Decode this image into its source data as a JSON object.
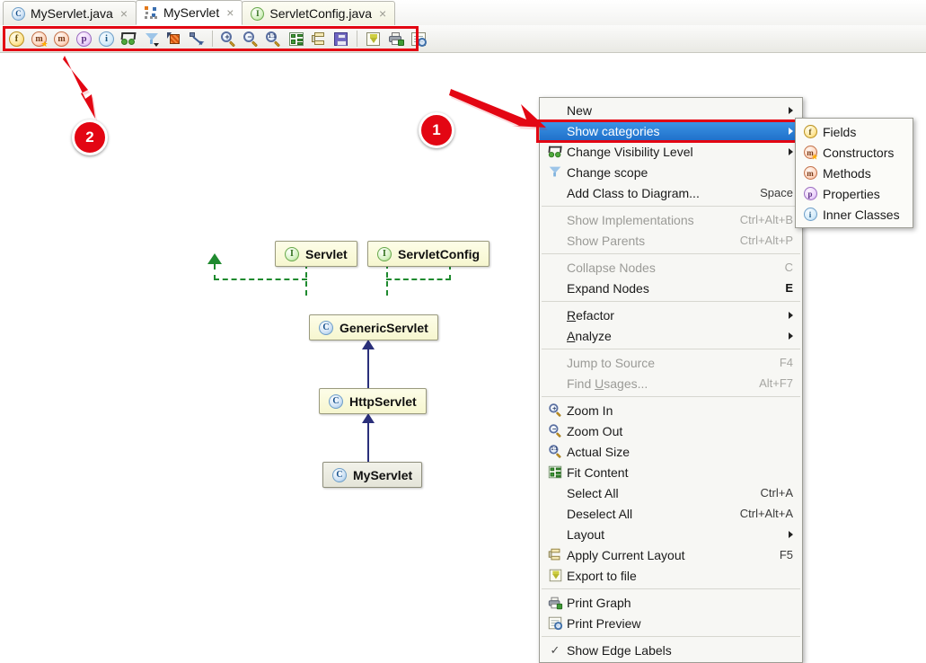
{
  "tabs": [
    {
      "label": "MyServlet.java",
      "icon": "class-icon",
      "glyph": "C",
      "active": false,
      "close": "×"
    },
    {
      "label": "MyServlet",
      "icon": "diagram-icon",
      "glyph": "",
      "active": true,
      "close": "×"
    },
    {
      "label": "ServletConfig.java",
      "icon": "interface-icon",
      "glyph": "I",
      "active": false,
      "close": "×"
    }
  ],
  "toolbar": {
    "buttons": [
      {
        "name": "show-fields-toggle",
        "icon": "fields-icon",
        "glyph": "f"
      },
      {
        "name": "show-constructors-toggle",
        "icon": "constructors-icon",
        "glyph": "m"
      },
      {
        "name": "show-methods-toggle",
        "icon": "methods-icon",
        "glyph": "m"
      },
      {
        "name": "show-properties-toggle",
        "icon": "properties-icon",
        "glyph": "p"
      },
      {
        "name": "show-inner-classes-toggle",
        "icon": "inner-classes-icon",
        "glyph": "i"
      },
      {
        "name": "change-visibility-level-button",
        "icon": "visibility-glasses-icon",
        "glyph": ""
      },
      {
        "name": "change-scope-button",
        "icon": "funnel-icon",
        "glyph": ""
      },
      {
        "name": "add-class-to-diagram-button",
        "icon": "node-select-icon",
        "glyph": ""
      },
      {
        "name": "show-edges-button",
        "icon": "diagonal-arrow-icon",
        "glyph": ""
      },
      {
        "name": "zoom-in-button",
        "icon": "zoom-in-icon",
        "glyph": "+"
      },
      {
        "name": "zoom-out-button",
        "icon": "zoom-out-icon",
        "glyph": "−"
      },
      {
        "name": "actual-size-button",
        "icon": "actual-size-icon",
        "glyph": "1:1"
      },
      {
        "name": "fit-content-button",
        "icon": "fit-content-icon",
        "glyph": ""
      },
      {
        "name": "apply-current-layout-button",
        "icon": "apply-layout-icon",
        "glyph": ""
      },
      {
        "name": "save-button",
        "icon": "floppy-icon",
        "glyph": ""
      },
      {
        "name": "export-to-file-button",
        "icon": "export-icon",
        "glyph": ""
      },
      {
        "name": "print-graph-button",
        "icon": "printer-icon",
        "glyph": ""
      },
      {
        "name": "print-preview-button",
        "icon": "print-preview-icon",
        "glyph": ""
      }
    ]
  },
  "diagram": {
    "nodes": [
      {
        "id": "servlet",
        "label": "Servlet",
        "kind": "interface",
        "glyph": "I",
        "style": "yellow"
      },
      {
        "id": "servletconfig",
        "label": "ServletConfig",
        "kind": "interface",
        "glyph": "I",
        "style": "yellow"
      },
      {
        "id": "genericservlet",
        "label": "GenericServlet",
        "kind": "class",
        "glyph": "C",
        "style": "yellow"
      },
      {
        "id": "httpservlet",
        "label": "HttpServlet",
        "kind": "class",
        "glyph": "C",
        "style": "yellow"
      },
      {
        "id": "myservlet",
        "label": "MyServlet",
        "kind": "class",
        "glyph": "C",
        "style": "gray"
      }
    ],
    "edges": [
      {
        "from": "genericservlet",
        "to": "servlet",
        "type": "implements"
      },
      {
        "from": "genericservlet",
        "to": "servletconfig",
        "type": "implements"
      },
      {
        "from": "httpservlet",
        "to": "genericservlet",
        "type": "extends"
      },
      {
        "from": "myservlet",
        "to": "httpservlet",
        "type": "extends"
      }
    ]
  },
  "context_menu": {
    "items": [
      {
        "label": "New",
        "accel": "",
        "icon": "",
        "submenu": true,
        "disabled": false,
        "selected": false,
        "mnemonic": ""
      },
      {
        "label": "Show categories",
        "accel": "",
        "icon": "",
        "submenu": true,
        "disabled": false,
        "selected": true,
        "mnemonic": ""
      },
      {
        "label": "Change Visibility Level",
        "accel": "",
        "icon": "visibility-glasses-icon",
        "submenu": true,
        "disabled": false,
        "selected": false,
        "mnemonic": ""
      },
      {
        "label": "Change scope",
        "accel": "",
        "icon": "funnel-icon",
        "submenu": true,
        "disabled": false,
        "selected": false,
        "mnemonic": ""
      },
      {
        "label": "Add Class to Diagram...",
        "accel": "Space",
        "icon": "",
        "submenu": false,
        "disabled": false,
        "selected": false,
        "mnemonic": ""
      },
      {
        "separator": true
      },
      {
        "label": "Show Implementations",
        "accel": "Ctrl+Alt+B",
        "icon": "",
        "submenu": false,
        "disabled": true,
        "selected": false,
        "mnemonic": ""
      },
      {
        "label": "Show Parents",
        "accel": "Ctrl+Alt+P",
        "icon": "",
        "submenu": false,
        "disabled": true,
        "selected": false,
        "mnemonic": ""
      },
      {
        "separator": true
      },
      {
        "label": "Collapse Nodes",
        "accel": "C",
        "icon": "",
        "submenu": false,
        "disabled": true,
        "selected": false,
        "mnemonic": ""
      },
      {
        "label": "Expand Nodes",
        "accel": "E",
        "icon": "",
        "submenu": false,
        "disabled": false,
        "selected": false,
        "mnemonic": ""
      },
      {
        "separator": true
      },
      {
        "label": "Refactor",
        "accel": "",
        "icon": "",
        "submenu": true,
        "disabled": false,
        "selected": false,
        "mnemonic": "R"
      },
      {
        "label": "Analyze",
        "accel": "",
        "icon": "",
        "submenu": true,
        "disabled": false,
        "selected": false,
        "mnemonic": "A"
      },
      {
        "separator": true
      },
      {
        "label": "Jump to Source",
        "accel": "F4",
        "icon": "",
        "submenu": false,
        "disabled": true,
        "selected": false,
        "mnemonic": ""
      },
      {
        "label": "Find Usages...",
        "accel": "Alt+F7",
        "icon": "",
        "submenu": false,
        "disabled": true,
        "selected": false,
        "mnemonic": "U"
      },
      {
        "separator": true
      },
      {
        "label": "Zoom In",
        "accel": "",
        "icon": "zoom-in-icon",
        "submenu": false,
        "disabled": false,
        "selected": false,
        "mnemonic": ""
      },
      {
        "label": "Zoom Out",
        "accel": "",
        "icon": "zoom-out-icon",
        "submenu": false,
        "disabled": false,
        "selected": false,
        "mnemonic": ""
      },
      {
        "label": "Actual Size",
        "accel": "",
        "icon": "actual-size-icon",
        "submenu": false,
        "disabled": false,
        "selected": false,
        "mnemonic": ""
      },
      {
        "label": "Fit Content",
        "accel": "",
        "icon": "fit-content-icon",
        "submenu": false,
        "disabled": false,
        "selected": false,
        "mnemonic": ""
      },
      {
        "label": "Select All",
        "accel": "Ctrl+A",
        "icon": "",
        "submenu": false,
        "disabled": false,
        "selected": false,
        "mnemonic": ""
      },
      {
        "label": "Deselect All",
        "accel": "Ctrl+Alt+A",
        "icon": "",
        "submenu": false,
        "disabled": false,
        "selected": false,
        "mnemonic": ""
      },
      {
        "label": "Layout",
        "accel": "",
        "icon": "",
        "submenu": true,
        "disabled": false,
        "selected": false,
        "mnemonic": ""
      },
      {
        "label": "Apply Current Layout",
        "accel": "F5",
        "icon": "apply-layout-icon",
        "submenu": false,
        "disabled": false,
        "selected": false,
        "mnemonic": ""
      },
      {
        "label": "Export to file",
        "accel": "",
        "icon": "export-icon",
        "submenu": false,
        "disabled": false,
        "selected": false,
        "mnemonic": ""
      },
      {
        "separator": true
      },
      {
        "label": "Print Graph",
        "accel": "",
        "icon": "printer-icon",
        "submenu": false,
        "disabled": false,
        "selected": false,
        "mnemonic": ""
      },
      {
        "label": "Print Preview",
        "accel": "",
        "icon": "print-preview-icon",
        "submenu": false,
        "disabled": false,
        "selected": false,
        "mnemonic": ""
      },
      {
        "separator": true
      },
      {
        "label": "Show Edge Labels",
        "accel": "",
        "icon": "check-icon",
        "submenu": false,
        "disabled": false,
        "selected": false,
        "checked": true,
        "mnemonic": ""
      }
    ]
  },
  "submenu": {
    "items": [
      {
        "label": "Fields",
        "icon": "fields-icon",
        "glyph": "f"
      },
      {
        "label": "Constructors",
        "icon": "constructors-icon",
        "glyph": "m"
      },
      {
        "label": "Methods",
        "icon": "methods-icon",
        "glyph": "m"
      },
      {
        "label": "Properties",
        "icon": "properties-icon",
        "glyph": "p"
      },
      {
        "label": "Inner Classes",
        "icon": "inner-classes-icon",
        "glyph": "i"
      }
    ]
  },
  "annotations": {
    "badges": [
      {
        "number": "1"
      },
      {
        "number": "2"
      }
    ],
    "accent_color": "#e30613"
  }
}
